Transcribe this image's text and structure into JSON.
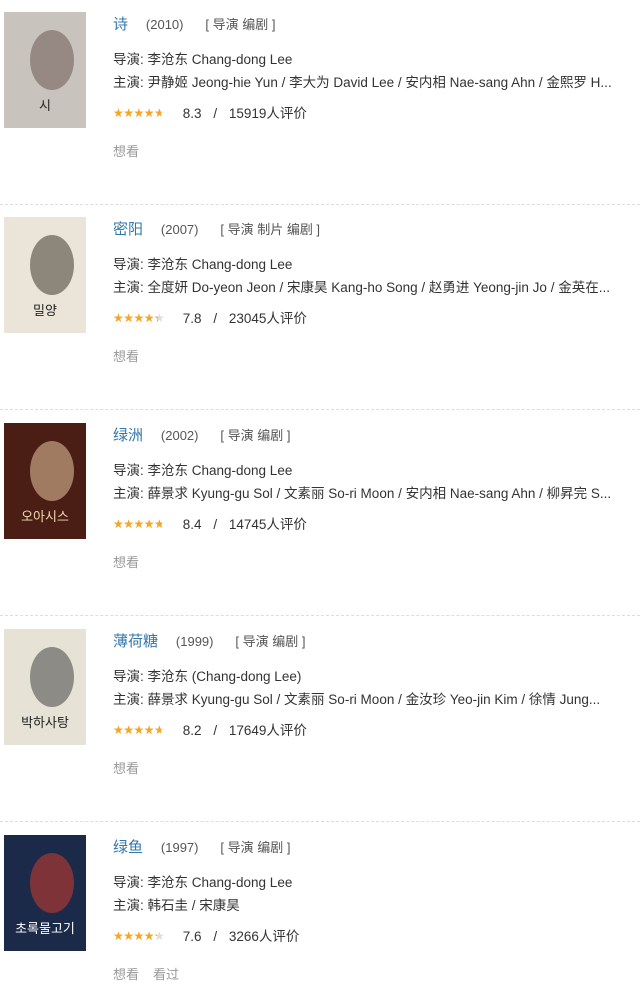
{
  "movies": [
    {
      "title": "诗",
      "year": "(2010)",
      "roles": "[ 导演 编剧 ]",
      "director": "导演: 李沧东 Chang-dong Lee",
      "cast": "主演: 尹静姬 Jeong-hie Yun / 李大为 David Lee / 安内相 Nae-sang Ahn / 金熙罗 H...",
      "score": "8.3",
      "rating_fraction": 0.83,
      "votes": "15919人评价",
      "actions": [
        "想看"
      ],
      "poster": {
        "bg": "#c9c3be",
        "accent": "#6b5a52",
        "text": "시"
      }
    },
    {
      "title": "密阳",
      "year": "(2007)",
      "roles": "[ 导演 制片 编剧 ]",
      "director": "导演: 李沧东 Chang-dong Lee",
      "cast": "主演: 全度妍 Do-yeon Jeon / 宋康昊 Kang-ho Song / 赵勇进 Yeong-jin Jo / 金英在...",
      "score": "7.8",
      "rating_fraction": 0.78,
      "votes": "23045人评价",
      "actions": [
        "想看"
      ],
      "poster": {
        "bg": "#ebe4d8",
        "accent": "#403830",
        "text": "밀양"
      }
    },
    {
      "title": "绿洲",
      "year": "(2002)",
      "roles": "[ 导演 编剧 ]",
      "director": "导演: 李沧东 Chang-dong Lee",
      "cast": "主演: 薛景求 Kyung-gu Sol / 文素丽 So-ri Moon / 安内相 Nae-sang Ahn / 柳昇完 S...",
      "score": "8.4",
      "rating_fraction": 0.84,
      "votes": "14745人评价",
      "actions": [
        "想看"
      ],
      "poster": {
        "bg": "#4a1e14",
        "accent": "#e8c9a0",
        "text": "오아시스"
      }
    },
    {
      "title": "薄荷糖",
      "year": "(1999)",
      "roles": "[ 导演 编剧 ]",
      "director": "导演: 李沧东 (Chang-dong Lee)",
      "cast": "主演: 薛景求 Kyung-gu Sol / 文素丽 So-ri Moon / 金汝珍 Yeo-jin Kim / 徐情 Jung...",
      "score": "8.2",
      "rating_fraction": 0.82,
      "votes": "17649人评价",
      "actions": [
        "想看"
      ],
      "poster": {
        "bg": "#e6e2d6",
        "accent": "#444",
        "text": "박하사탕"
      }
    },
    {
      "title": "绿鱼",
      "year": "(1997)",
      "roles": "[ 导演 编剧 ]",
      "director": "导演: 李沧东 Chang-dong Lee",
      "cast": "主演: 韩石圭 / 宋康昊",
      "score": "7.6",
      "rating_fraction": 0.76,
      "votes": "3266人评价",
      "actions": [
        "想看",
        "看过"
      ],
      "poster": {
        "bg": "#1c2a4a",
        "accent": "#d03a2a",
        "text": "초록물고기"
      }
    }
  ]
}
